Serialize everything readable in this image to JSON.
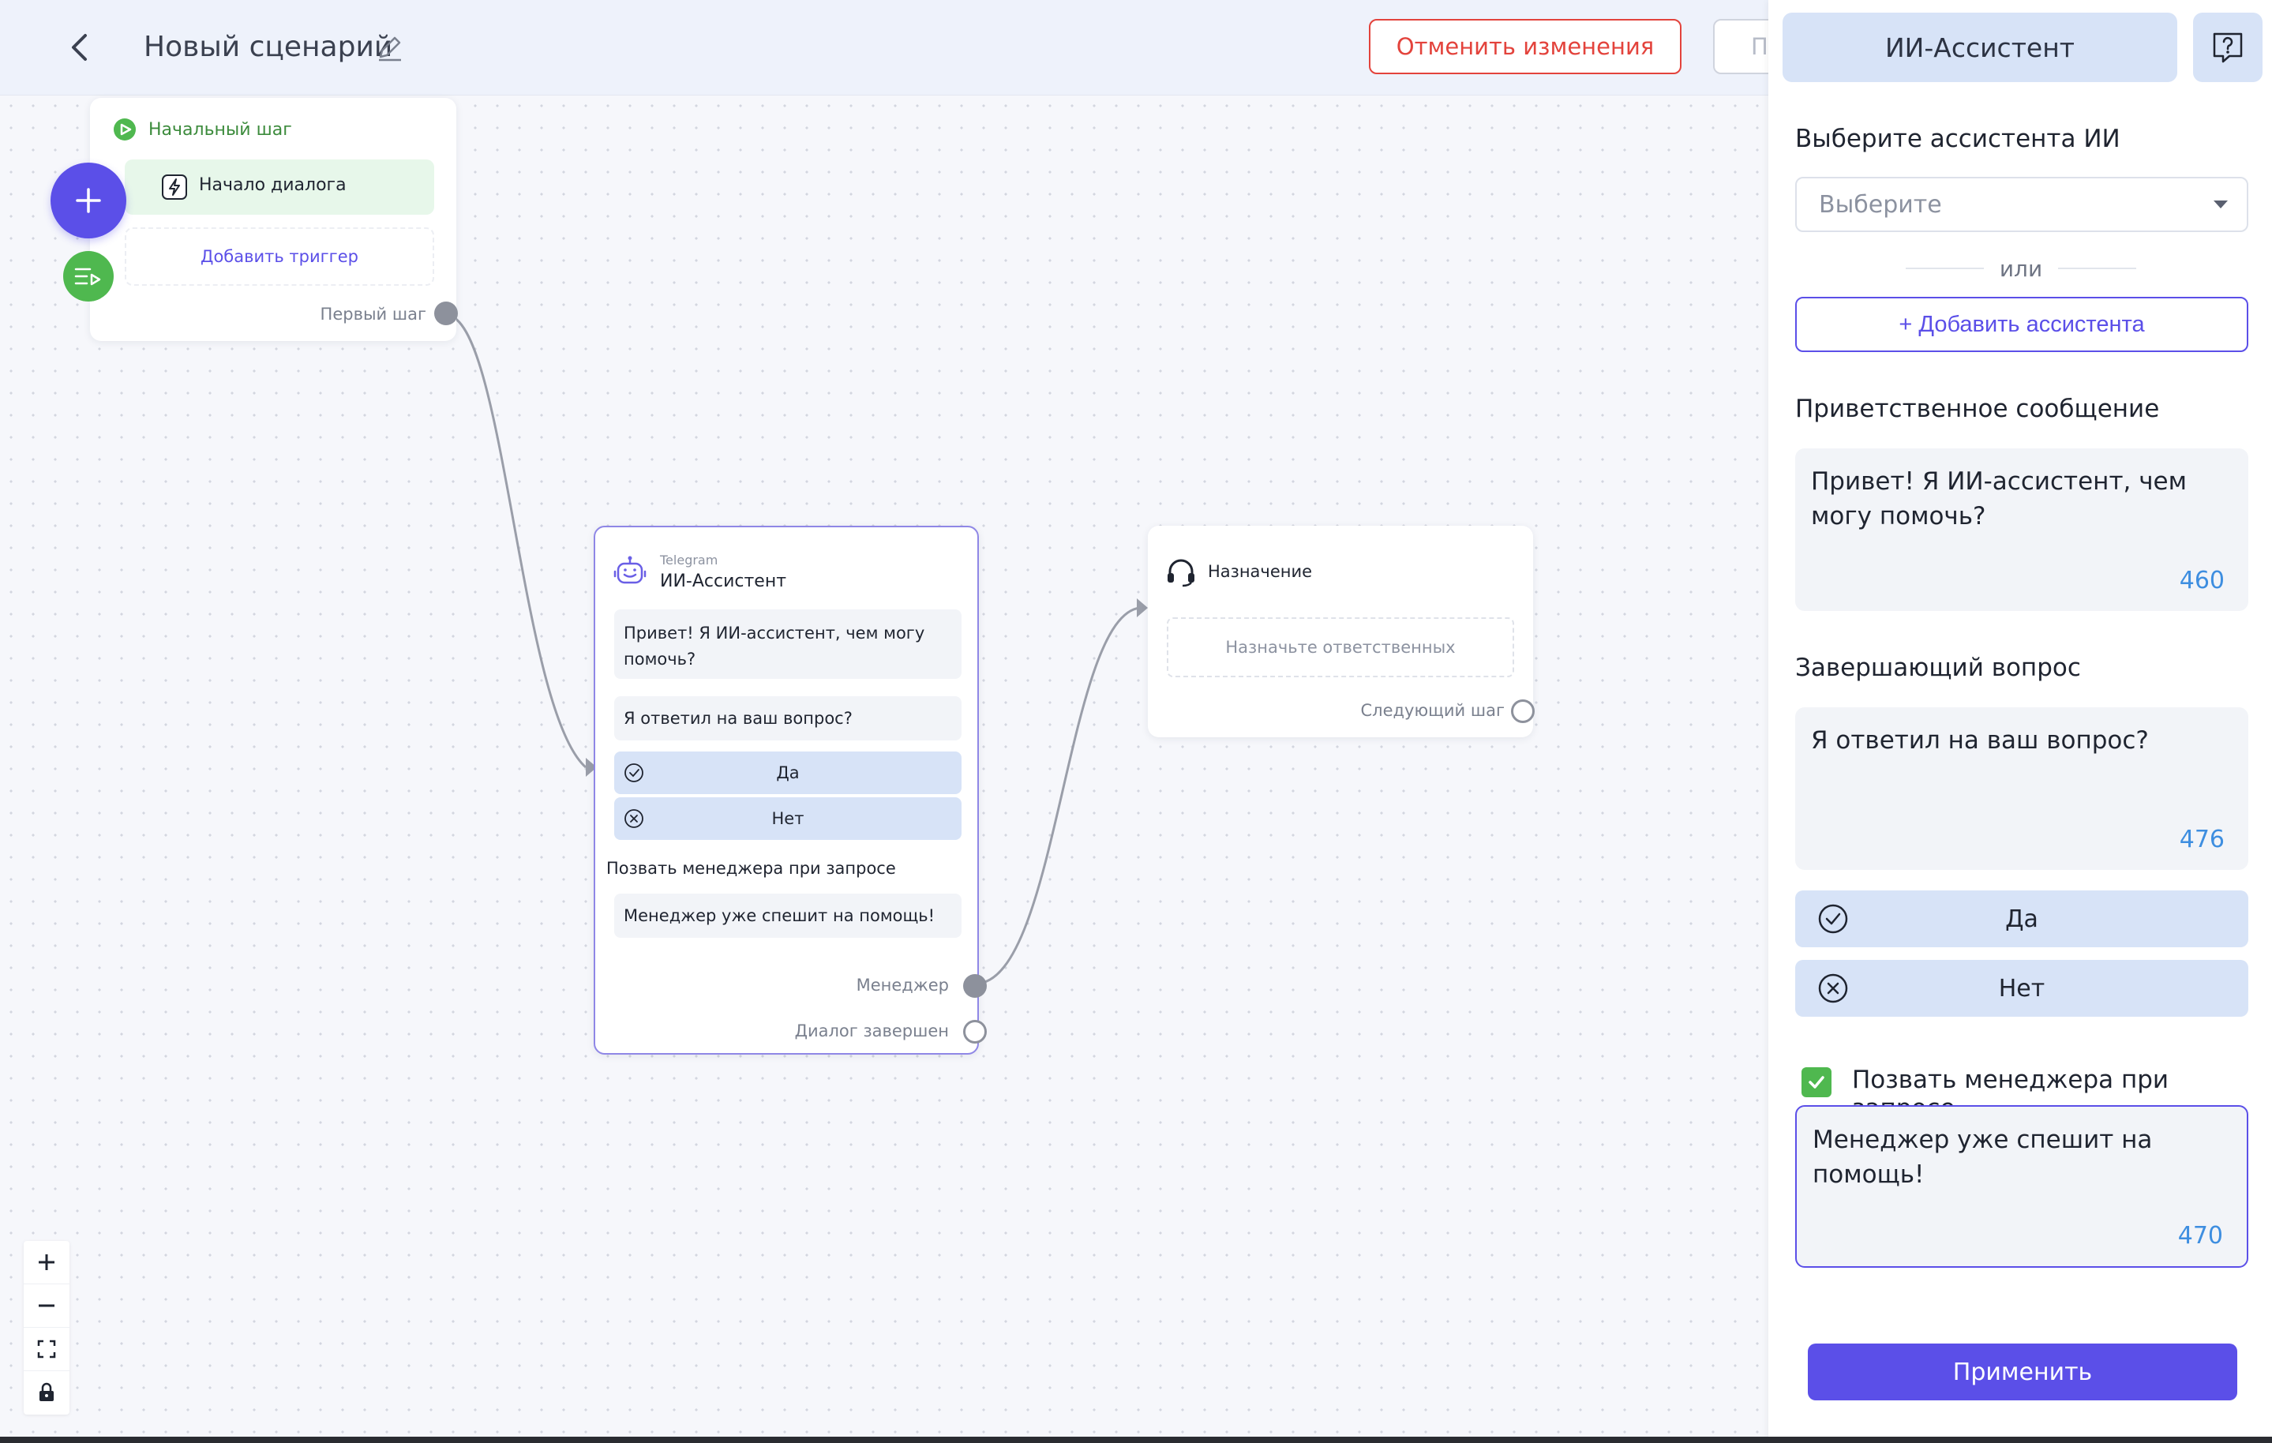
{
  "header": {
    "back_icon": "chevron-left-icon",
    "title": "Новый сценарий",
    "edit_icon": "pencil-icon",
    "cancel_label": "Отменить изменения",
    "partial_button_label": "П"
  },
  "canvas": {
    "start_node": {
      "title": "Начальный шаг",
      "trigger": "Начало диалога",
      "add_trigger": "Добавить триггер",
      "port_label": "Первый шаг"
    },
    "ai_node": {
      "channel": "Telegram",
      "title": "ИИ-Ассистент",
      "greeting": "Привет! Я ИИ-ассистент, чем могу помочь?",
      "question": "Я ответил на ваш вопрос?",
      "options": [
        {
          "label": "Да",
          "icon": "check-circle-icon"
        },
        {
          "label": "Нет",
          "icon": "x-circle-icon"
        }
      ],
      "manager_label": "Позвать менеджера при запросе",
      "manager_message": "Менеджер уже спешит на помощь!",
      "ports": [
        "Менеджер",
        "Диалог завершен"
      ]
    },
    "assign_node": {
      "title": "Назначение",
      "placeholder": "Назначьте ответственных",
      "port_label": "Следующий шаг"
    },
    "zoom_controls": [
      "plus-icon",
      "minus-icon",
      "fit-screen-icon",
      "lock-icon"
    ]
  },
  "panel": {
    "title": "ИИ-Ассистент",
    "help_icon": "help-question-icon",
    "select_label": "Выберите ассистента ИИ",
    "select_placeholder": "Выберите",
    "or_text": "или",
    "add_assistant": "+ Добавить ассистента",
    "greeting_label": "Приветственное сообщение",
    "greeting_text": "Привет! Я ИИ-ассистент, чем могу помочь?",
    "greeting_counter": "460",
    "question_label": "Завершающий вопрос",
    "question_text": "Я ответил на ваш вопрос?",
    "question_counter": "476",
    "options": [
      {
        "label": "Да",
        "icon": "check-circle-icon"
      },
      {
        "label": "Нет",
        "icon": "x-circle-icon"
      }
    ],
    "manager_checkbox_checked": true,
    "manager_checkbox_label": "Позвать менеджера при запросе",
    "manager_text": "Менеджер уже спешит на помощь!",
    "manager_counter": "470",
    "apply": "Применить"
  },
  "colors": {
    "accent": "#5b4fe8",
    "danger": "#e3433c",
    "success": "#4fb84f",
    "option_bg": "#d7e3f7",
    "counter": "#3e8ee0"
  }
}
